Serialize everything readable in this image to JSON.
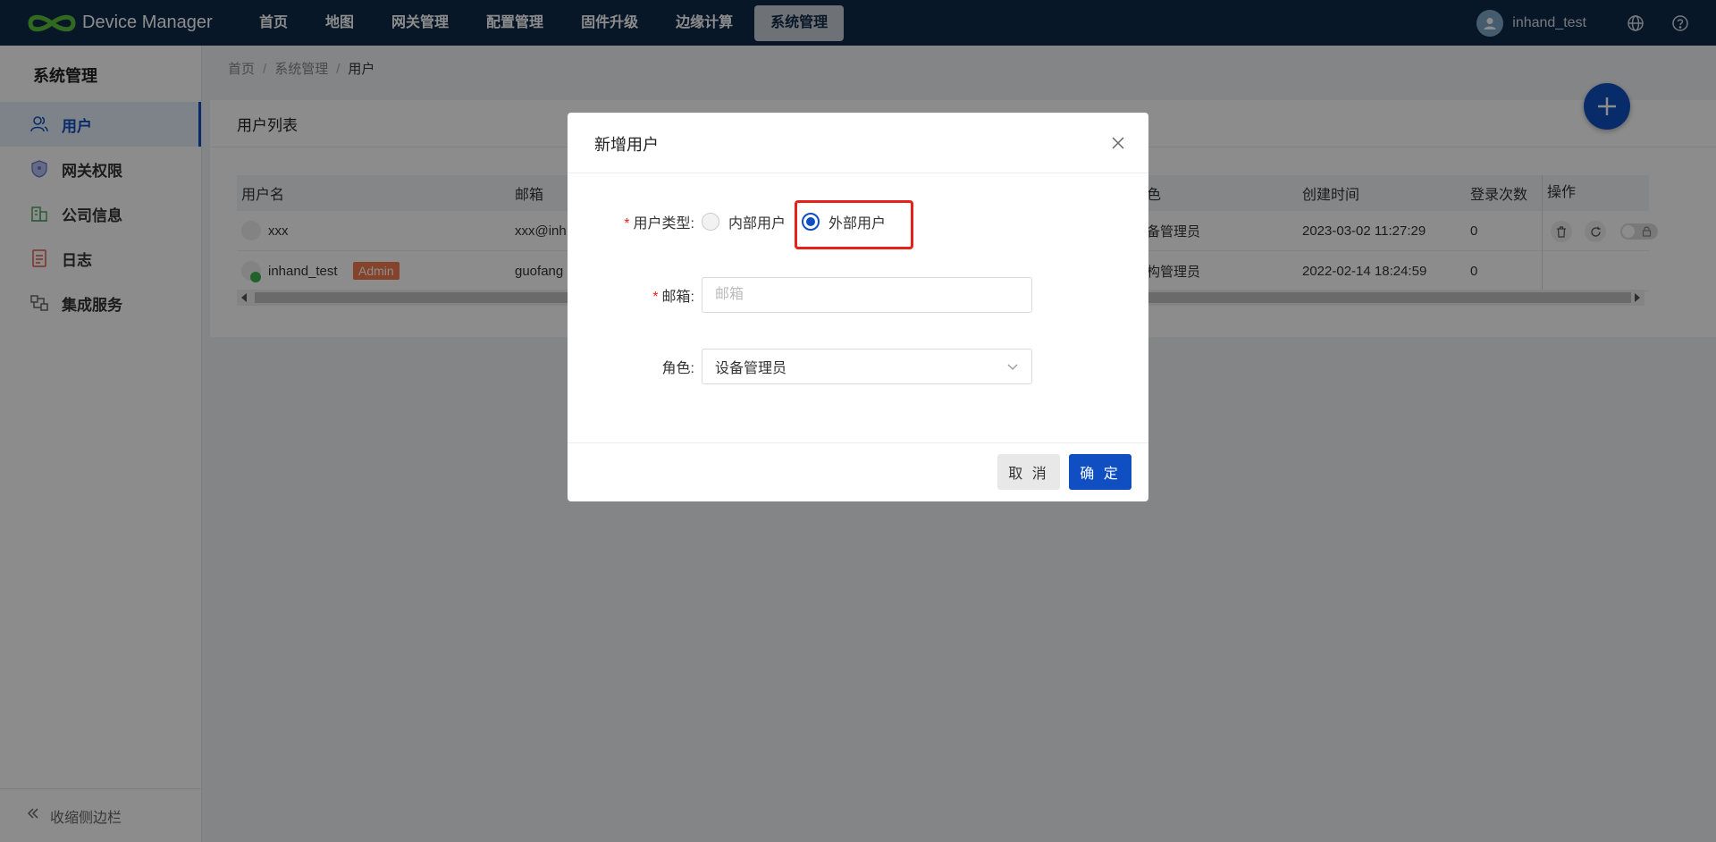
{
  "app": {
    "title": "Device Manager"
  },
  "nav": [
    "首页",
    "地图",
    "网关管理",
    "配置管理",
    "固件升级",
    "边缘计算",
    "系统管理"
  ],
  "header": {
    "user": "inhand_test"
  },
  "sidebar": {
    "title": "系统管理",
    "items": [
      {
        "label": "用户",
        "icon": "users-icon"
      },
      {
        "label": "网关权限",
        "icon": "shield-icon"
      },
      {
        "label": "公司信息",
        "icon": "company-icon"
      },
      {
        "label": "日志",
        "icon": "log-icon"
      },
      {
        "label": "集成服务",
        "icon": "integration-icon"
      }
    ],
    "collapse": "收缩侧边栏"
  },
  "breadcrumb": {
    "home": "首页",
    "section": "系统管理",
    "current": "用户"
  },
  "card": {
    "title": "用户列表"
  },
  "table": {
    "headers": [
      "用户名",
      "邮箱",
      "色",
      "创建时间",
      "登录次数",
      "操作"
    ],
    "rows": [
      {
        "username": "xxx",
        "email": "xxx@inh",
        "role": "备管理员",
        "created": "2023-03-02 11:27:29",
        "logins": "0"
      },
      {
        "username": "inhand_test",
        "badge": "Admin",
        "email": "guofang",
        "role": "构管理员",
        "created": "2022-02-14 18:24:59",
        "logins": "0"
      }
    ]
  },
  "modal": {
    "title": "新增用户",
    "user_type_label": "用户类型",
    "internal": "内部用户",
    "external": "外部用户",
    "email_label": "邮箱",
    "email_placeholder": "邮箱",
    "role_label": "角色",
    "role_value": "设备管理员",
    "cancel": "取 消",
    "ok": "确 定"
  },
  "colors": {
    "primary": "#0f4fc2",
    "topbar": "#0f2a4a",
    "highlight": "#e8201a",
    "badge": "#f07a4d"
  }
}
